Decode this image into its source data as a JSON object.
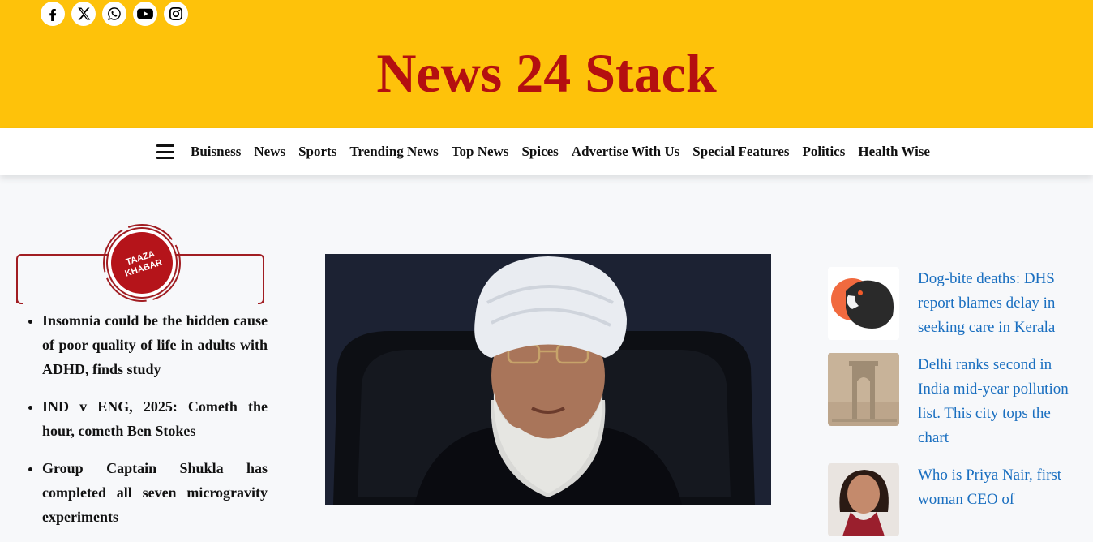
{
  "site": {
    "title": "News 24 Stack"
  },
  "social": [
    {
      "icon": "facebook-icon"
    },
    {
      "icon": "x-icon"
    },
    {
      "icon": "whatsapp-icon"
    },
    {
      "icon": "youtube-icon"
    },
    {
      "icon": "instagram-icon"
    }
  ],
  "nav": {
    "items": [
      {
        "label": "Buisness"
      },
      {
        "label": "News"
      },
      {
        "label": "Sports"
      },
      {
        "label": "Trending News"
      },
      {
        "label": "Top News"
      },
      {
        "label": "Spices"
      },
      {
        "label": "Advertise With Us"
      },
      {
        "label": "Special Features"
      },
      {
        "label": "Politics"
      },
      {
        "label": "Health Wise"
      }
    ]
  },
  "taaza": {
    "badge_line1": "TAAZA",
    "badge_line2": "KHABAR",
    "items": [
      {
        "text": "Insomnia could be the hidden cause of poor quality of life in adults with ADHD, finds study"
      },
      {
        "text": "IND v ENG, 2025: Cometh the hour, cometh Ben Stokes"
      },
      {
        "text": "Group Captain Shukla has completed all seven microgravity experiments"
      }
    ]
  },
  "side_news": [
    {
      "text": "Dog-bite deaths: DHS report blames delay in seeking care in Kerala",
      "thumb": "dog-image"
    },
    {
      "text": "Delhi ranks second in India mid-year pollution list. This city tops the chart",
      "thumb": "india-gate-smog-image"
    },
    {
      "text": "Who is Priya Nair, first woman CEO of",
      "thumb": "woman-portrait-image"
    }
  ],
  "colors": {
    "header_bg": "#fec20a",
    "title": "#b40f10",
    "accent_red": "#a11d22",
    "link_blue": "#1a6fc0"
  }
}
